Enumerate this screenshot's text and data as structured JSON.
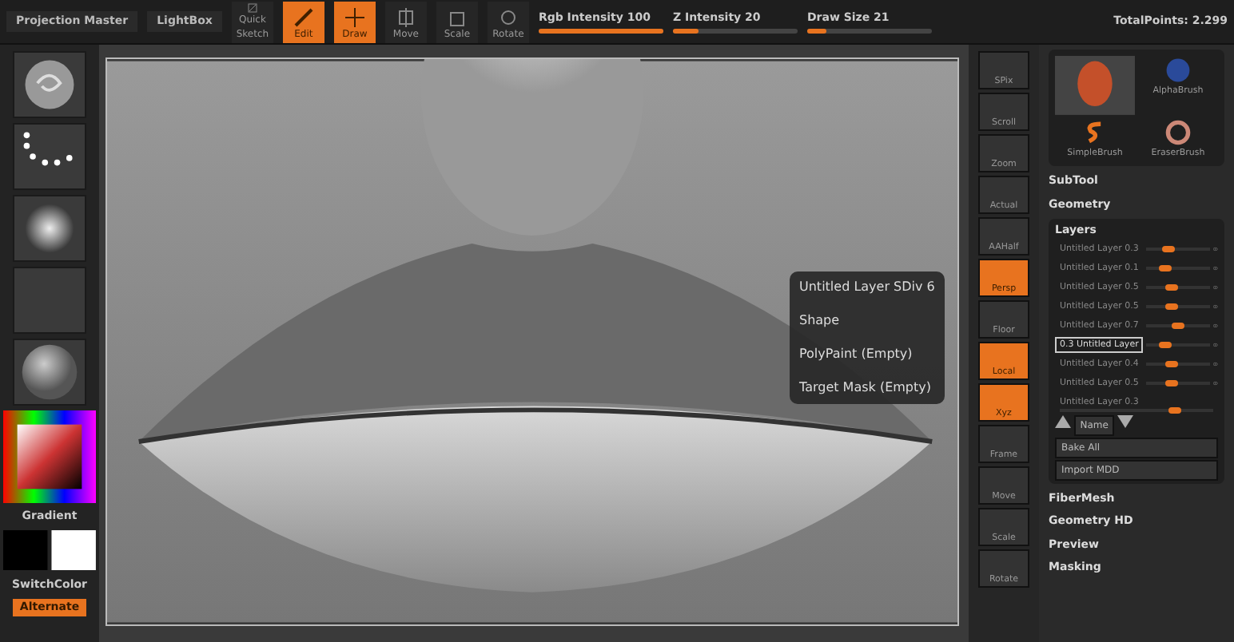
{
  "top_bar": {
    "groups": [
      {
        "label": "Projection Master"
      },
      {
        "label": "LightBox"
      }
    ],
    "tools": [
      {
        "label": "Quick Sketch",
        "on": false,
        "kind": "sketch"
      },
      {
        "label": "Edit",
        "on": true,
        "kind": "pencil"
      },
      {
        "label": "Draw",
        "on": true,
        "kind": "draw"
      },
      {
        "label": "Move",
        "on": false,
        "kind": "move"
      },
      {
        "label": "Scale",
        "on": false,
        "kind": "scale"
      },
      {
        "label": "Rotate",
        "on": false,
        "kind": "rotate"
      }
    ],
    "sliders": [
      {
        "label": "Rgb Intensity 100",
        "level": 1
      },
      {
        "label": "Z Intensity 20",
        "level": 0.2
      },
      {
        "label": "Draw Size 21",
        "level": 0.15
      }
    ],
    "stats": "TotalPoints: 2.299"
  },
  "left_shelf": {
    "thumbs": [
      {
        "kind": "brush"
      },
      {
        "kind": "stroke"
      },
      {
        "kind": "alpha"
      },
      {
        "kind": "texture"
      },
      {
        "kind": "material"
      }
    ],
    "gradient": "Gradient",
    "switch_color": "SwitchColor",
    "alternate": "Alternate"
  },
  "right_shelf": [
    {
      "label": "SPix",
      "on": false
    },
    {
      "label": "Scroll",
      "on": false
    },
    {
      "label": "Zoom",
      "on": false
    },
    {
      "label": "Actual",
      "on": false
    },
    {
      "label": "AAHalf",
      "on": false
    },
    {
      "label": "Persp",
      "on": true
    },
    {
      "label": "Floor",
      "on": false
    },
    {
      "label": "Local",
      "on": true
    },
    {
      "label": "Xyz",
      "on": true
    },
    {
      "label": "Frame",
      "on": false
    },
    {
      "label": "Move",
      "on": false
    },
    {
      "label": "Scale",
      "on": false
    },
    {
      "label": "Rotate",
      "on": false
    }
  ],
  "popup": {
    "items": [
      "Untitled Layer SDiv 6",
      "Shape",
      "PolyPaint (Empty)",
      "Target Mask (Empty)"
    ]
  },
  "brushes": [
    "AlphaBrush",
    "SimpleBrush",
    "EraserBrush"
  ],
  "panel": {
    "sections_top": [
      "SubTool",
      "Geometry"
    ],
    "layers_title": "Layers",
    "layers": [
      {
        "label": "Untitled Layer 0.3",
        "level": 0.35,
        "selected": false
      },
      {
        "label": "Untitled Layer 0.1",
        "level": 0.3,
        "selected": false
      },
      {
        "label": "Untitled Layer 0.5",
        "level": 0.4,
        "selected": false
      },
      {
        "label": "Untitled Layer 0.5",
        "level": 0.4,
        "selected": false
      },
      {
        "label": "Untitled Layer 0.7",
        "level": 0.5,
        "selected": false
      },
      {
        "label": "0.3 Untitled Layer",
        "level": 0.3,
        "selected": true
      },
      {
        "label": "Untitled Layer 0.4",
        "level": 0.4,
        "selected": false
      },
      {
        "label": "Untitled Layer 0.5",
        "level": 0.4,
        "selected": false
      }
    ],
    "strength": {
      "label": "Untitled Layer 0.3",
      "level": 0.75
    },
    "name_button": "Name",
    "bake": "Bake All",
    "import": "Import MDD",
    "sections_bottom": [
      "FiberMesh",
      "Geometry HD",
      "Preview",
      "Masking"
    ]
  }
}
